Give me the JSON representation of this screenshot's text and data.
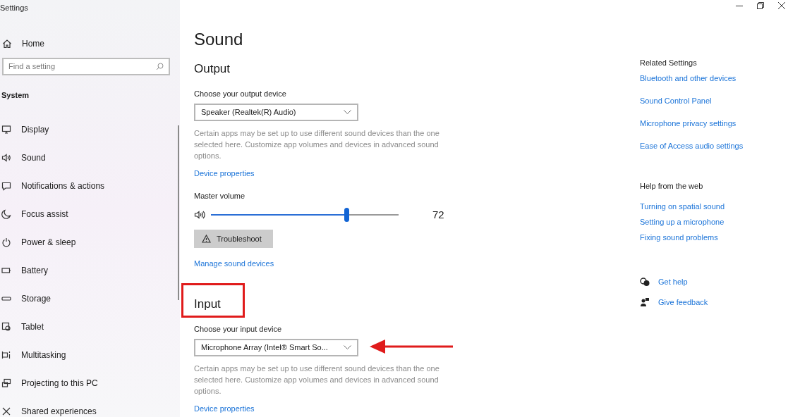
{
  "window": {
    "title": "Settings"
  },
  "sidebar": {
    "home": "Home",
    "search": {
      "placeholder": "Find a setting"
    },
    "section": "System",
    "items": [
      {
        "label": "Display"
      },
      {
        "label": "Sound"
      },
      {
        "label": "Notifications & actions"
      },
      {
        "label": "Focus assist"
      },
      {
        "label": "Power & sleep"
      },
      {
        "label": "Battery"
      },
      {
        "label": "Storage"
      },
      {
        "label": "Tablet"
      },
      {
        "label": "Multitasking"
      },
      {
        "label": "Projecting to this PC"
      },
      {
        "label": "Shared experiences"
      }
    ]
  },
  "page": {
    "title": "Sound",
    "output": {
      "heading": "Output",
      "device_label": "Choose your output device",
      "device": "Speaker (Realtek(R) Audio)",
      "note": "Certain apps may be set up to use different sound devices than the one selected here. Customize app volumes and devices in advanced sound options.",
      "properties_link": "Device properties",
      "volume_label": "Master volume",
      "volume": {
        "level": 0.72,
        "reading": "72"
      },
      "troubleshoot": "Troubleshoot",
      "manage_link": "Manage sound devices"
    },
    "input": {
      "heading": "Input",
      "device_label": "Choose your input device",
      "device": "Microphone Array (Intel® Smart So...",
      "note": "Certain apps may be set up to use different sound devices than the one selected here. Customize app volumes and devices in advanced sound options.",
      "properties_link": "Device properties"
    }
  },
  "related": {
    "heading": "Related Settings",
    "links": [
      "Bluetooth and other devices",
      "Sound Control Panel",
      "Microphone privacy settings",
      "Ease of Access audio settings"
    ]
  },
  "help": {
    "heading": "Help from the web",
    "links": [
      "Turning on spatial sound",
      "Setting up a microphone",
      "Fixing sound problems"
    ]
  },
  "support": [
    {
      "kind": "help",
      "label": "Get help"
    },
    {
      "kind": "feedback",
      "label": "Give feedback"
    }
  ]
}
